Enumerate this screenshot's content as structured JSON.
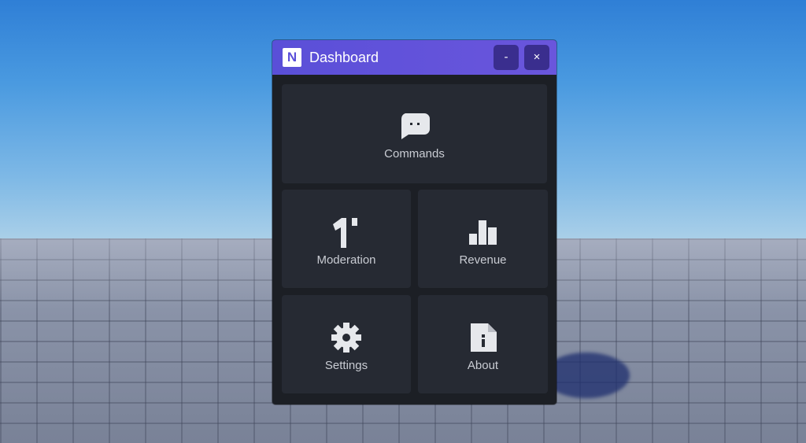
{
  "window": {
    "title": "Dashboard",
    "logo_letter": "N",
    "minimize_label": "-",
    "close_label": "×",
    "accent_color": "#5b50d9"
  },
  "tiles": [
    {
      "label": "Commands",
      "icon": "chat-bubble-icon"
    },
    {
      "label": "Moderation",
      "icon": "hammer-icon"
    },
    {
      "label": "Revenue",
      "icon": "bar-chart-icon"
    },
    {
      "label": "Settings",
      "icon": "gear-icon"
    },
    {
      "label": "About",
      "icon": "info-document-icon"
    }
  ]
}
